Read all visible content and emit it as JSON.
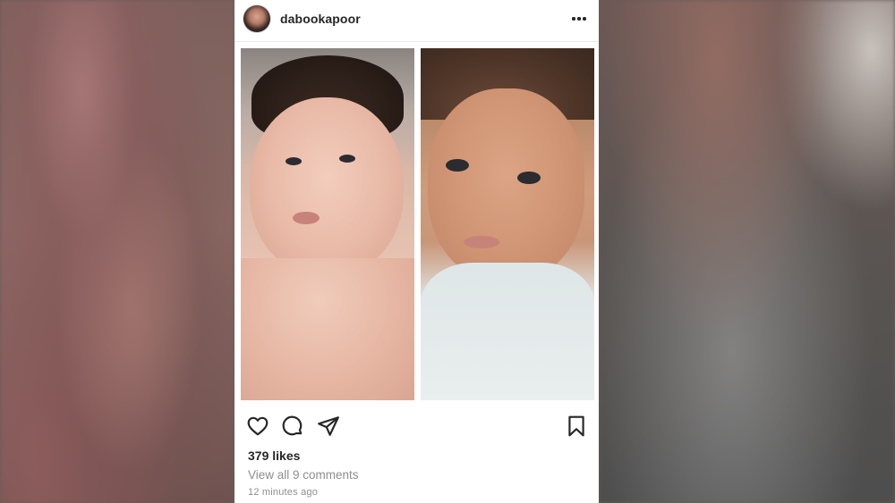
{
  "post": {
    "username": "dabookapoor",
    "likes": "379 likes",
    "comments_link": "View all 9 comments",
    "timestamp": "12 minutes ago"
  },
  "icons": {
    "more": "more-options-icon",
    "like": "heart-icon",
    "comment": "comment-icon",
    "share": "paper-plane-icon",
    "save": "bookmark-icon"
  },
  "colors": {
    "text": "#262626",
    "muted": "#8e8e8e",
    "card": "#ffffff"
  }
}
